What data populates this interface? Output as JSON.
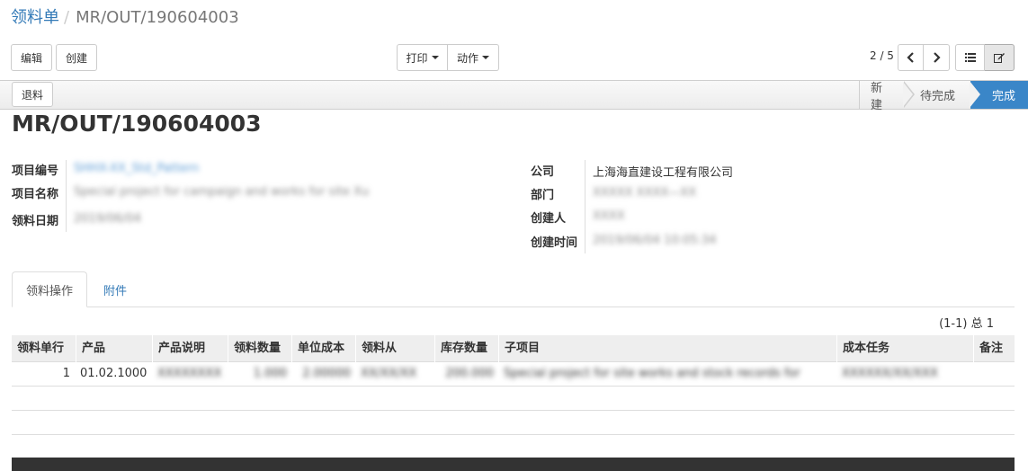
{
  "breadcrumb": {
    "parent": "领料单",
    "separator": "/",
    "current": "MR/OUT/190604003"
  },
  "toolbar": {
    "edit_label": "编辑",
    "create_label": "创建",
    "print_label": "打印",
    "action_label": "动作",
    "pager": "2 / 5"
  },
  "statusbar": {
    "return_label": "退料",
    "stages": [
      "新建",
      "待完成",
      "完成"
    ],
    "active_stage": "完成",
    "accent_color": "#3a86c8"
  },
  "record": {
    "title": "MR/OUT/190604003",
    "left_fields": [
      {
        "label": "项目编号",
        "value": "SHHX-XX_Std_Pattern"
      },
      {
        "label": "项目名称",
        "value": "Special project for campaign and works for site Xu"
      },
      {
        "label": "领料日期",
        "value": "2019/06/04"
      }
    ],
    "right_fields": [
      {
        "label": "公司",
        "value": "上海海直建设工程有限公司"
      },
      {
        "label": "部门",
        "value": "XXXXX XXXX—XX"
      },
      {
        "label": "创建人",
        "value": "XXXX"
      },
      {
        "label": "创建时间",
        "value": "2019/06/04 10:05:34"
      }
    ]
  },
  "tabs": [
    {
      "label": "领料操作",
      "active": true
    },
    {
      "label": "附件",
      "active": false
    }
  ],
  "table": {
    "record_count": "(1-1) 总 1",
    "columns": [
      "领料单行",
      "产品",
      "产品说明",
      "领料数量",
      "单位成本",
      "领料从",
      "库存数量",
      "子项目",
      "成本任务",
      "备注"
    ],
    "rows": [
      {
        "line": "1",
        "product": "01.02.1000",
        "description": "XXXXXXXX",
        "quantity": "1.000",
        "unit_cost": "2.00000",
        "source": "XX/XX/XX",
        "stock": "200.000",
        "subproject": "Special project for site works and stock records for",
        "cost_task": "XXXXXX/XX/XXX",
        "note": ""
      }
    ]
  }
}
